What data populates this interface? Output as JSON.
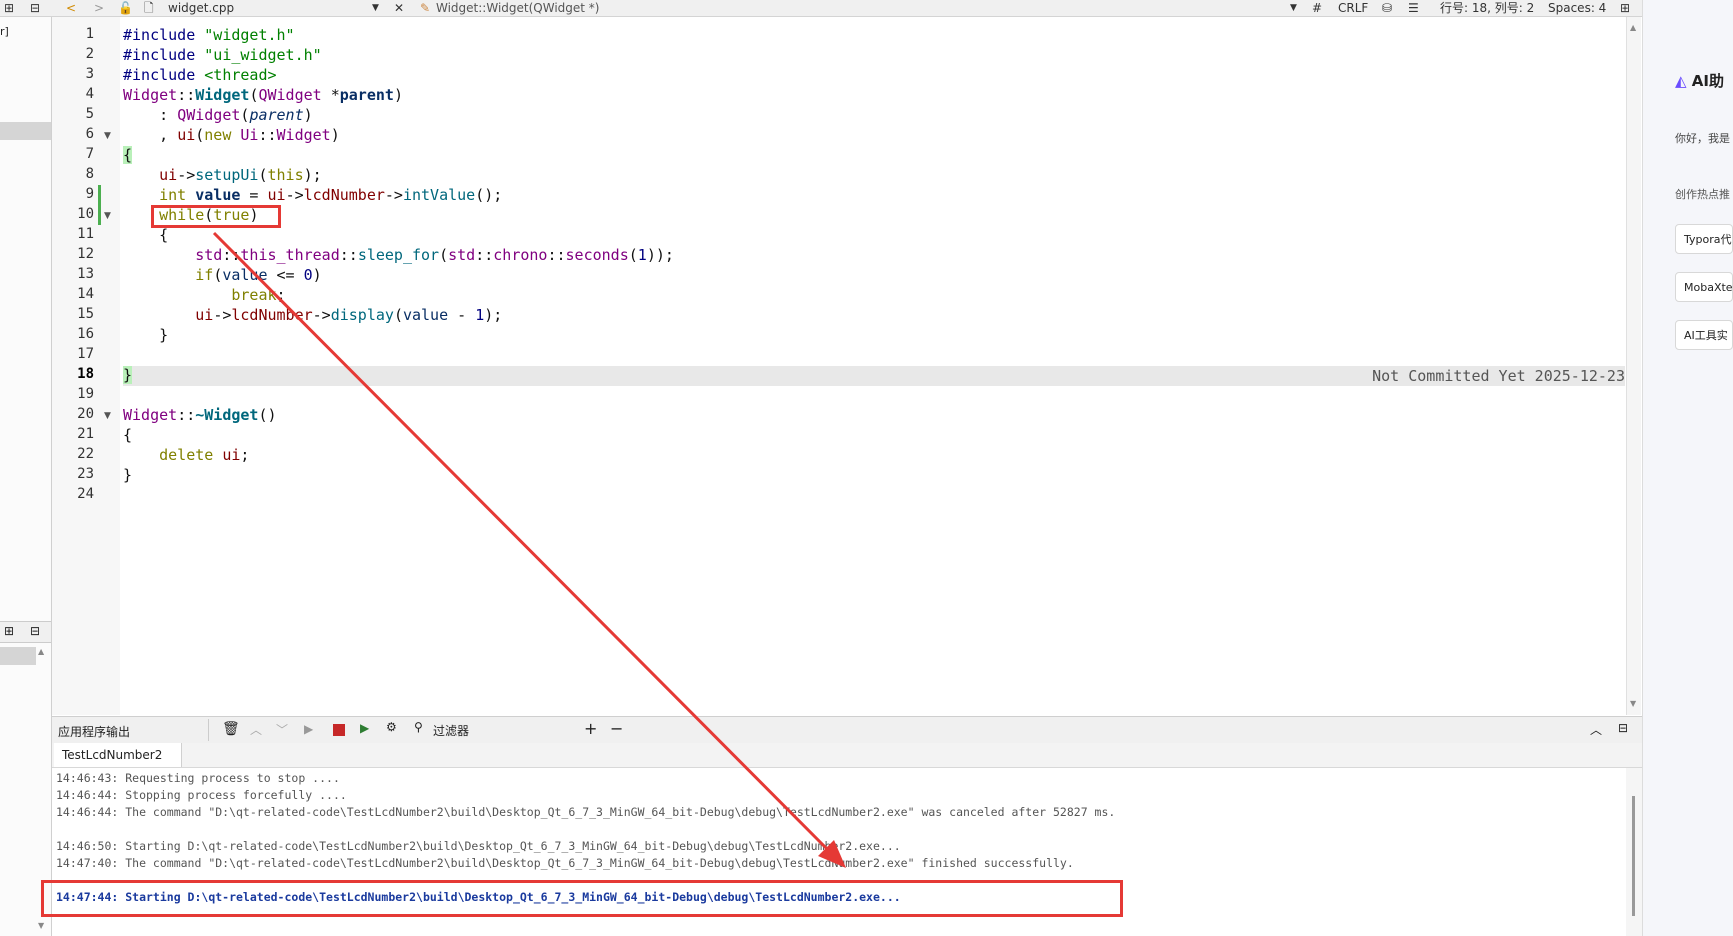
{
  "toolbar": {
    "filename": "widget.cpp",
    "function": "Widget::Widget(QWidget *)",
    "hash": "#",
    "line_ending": "CRLF",
    "position": "行号: 18, 列号: 2",
    "indent": "Spaces: 4"
  },
  "left_strip": {
    "label": "r]"
  },
  "code": {
    "line_numbers": [
      "1",
      "2",
      "3",
      "4",
      "5",
      "6",
      "7",
      "8",
      "9",
      "10",
      "11",
      "12",
      "13",
      "14",
      "15",
      "16",
      "17",
      "18",
      "19",
      "20",
      "21",
      "22",
      "23",
      "24"
    ],
    "blame": "Not Committed Yet 2025-12-23"
  },
  "output": {
    "title": "应用程序输出",
    "filter_label": "过滤器",
    "tab": "TestLcdNumber2",
    "lines": [
      "14:46:43: Requesting process to stop ....",
      "14:46:44: Stopping process forcefully ....",
      "14:46:44: The command \"D:\\qt-related-code\\TestLcdNumber2\\build\\Desktop_Qt_6_7_3_MinGW_64_bit-Debug\\debug\\TestLcdNumber2.exe\" was canceled after 52827 ms.",
      "",
      "14:46:50: Starting D:\\qt-related-code\\TestLcdNumber2\\build\\Desktop_Qt_6_7_3_MinGW_64_bit-Debug\\debug\\TestLcdNumber2.exe...",
      "14:47:40: The command \"D:\\qt-related-code\\TestLcdNumber2\\build\\Desktop_Qt_6_7_3_MinGW_64_bit-Debug\\debug\\TestLcdNumber2.exe\" finished successfully.",
      "",
      "14:47:44: Starting D:\\qt-related-code\\TestLcdNumber2\\build\\Desktop_Qt_6_7_3_MinGW_64_bit-Debug\\debug\\TestLcdNumber2.exe..."
    ]
  },
  "right_panel": {
    "title": "AI助",
    "greeting": "你好，我是",
    "hot": "创作热点推",
    "items": [
      "Typora代",
      "MobaXte",
      "AI工具实"
    ]
  },
  "colors": {
    "annotation": "#e53935",
    "accent_purple": "#6a4cff"
  }
}
